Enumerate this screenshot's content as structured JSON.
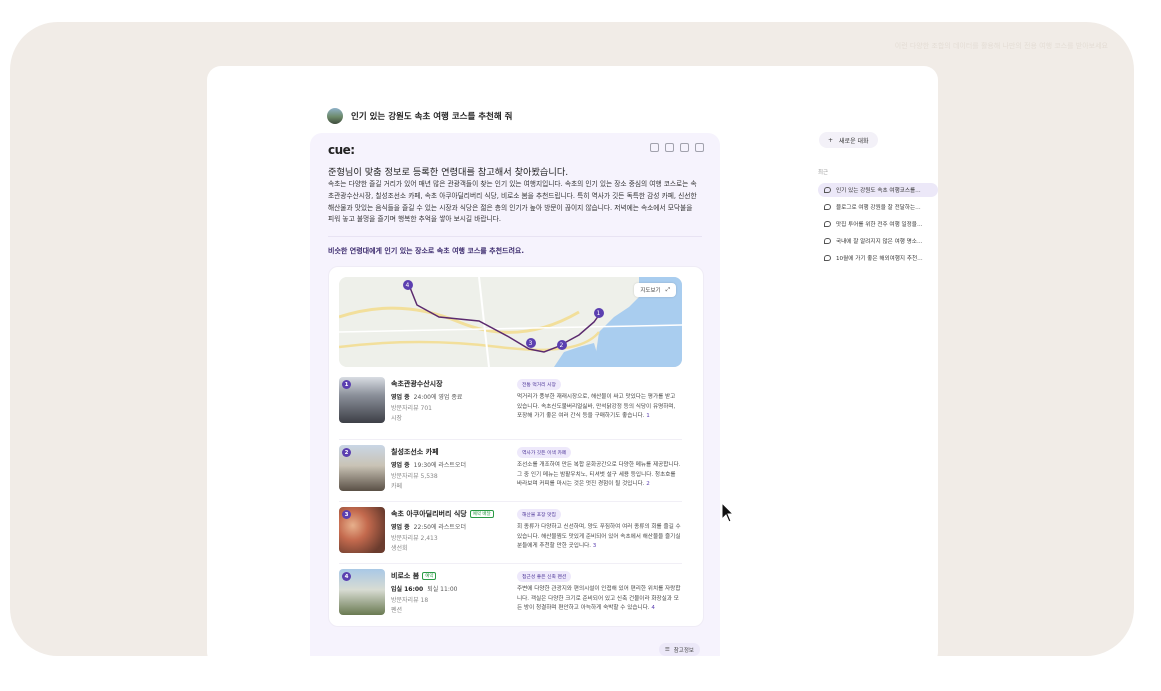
{
  "background_hint": "이런 다양한 조합의 데이터를 활용해 나만의 전용 여행 코스를 받아보세요",
  "question": {
    "text": "인기 있는 강원도 속초 여행 코스를 추천해 줘"
  },
  "answer": {
    "logo": "cue:",
    "actions": [
      "copy-icon",
      "thumbs-up-icon",
      "thumbs-down-icon",
      "share-icon"
    ],
    "heading": "준형님이 맞춤 정보로 등록한 연령대를 참고해서 찾아봤습니다.",
    "body": "속초는 다양한 즐길 거리가 있어 매년 많은 관광객들이 찾는 인기 있는 여행지입니다. 속초의 인기 있는 장소 중심의 여행 코스로는 속초관광수산시장, 칠성조선소 카페, 속초 아쿠아딜리버리 식당, 비로소 봄을 추천드립니다. 특히 역사가 깃든 독특한 감성 카페, 신선한 해산물과 맛있는 음식들을 즐길 수 있는 시장과 식당은 젊은 층의 인기가 높아 방문이 끊이지 않습니다. 저녁에는 속소에서 모닥불을 피워 놓고 불멍을 즐기며 행복한 추억을 쌓아 보시길 바랍니다.",
    "sub_heading": "비슷한 연령대에게 인기 있는 장소로 속초 여행 코스를 추천드려요.",
    "map_button": "지도보기",
    "places": [
      {
        "num": "1",
        "name": "속초관광수산시장",
        "badge": "",
        "status_open": "영업 중",
        "status_detail": "24:00에 영업 종료",
        "reviews": "방문자리뷰 701",
        "category": "시장",
        "tag": "전통 먹거리 시장",
        "desc": "먹거리가 풍부한 재래시장으로, 해산물이 싸고 맛있다는 평가를 받고 있습니다. 속초신도불버리얼싫바, 만석닭강정 등의 식당이 유명하며, 포장해 가기 좋은 여러 간식 등을 구매하기도 좋습니다.",
        "ref": "1"
      },
      {
        "num": "2",
        "name": "칠성조선소 카페",
        "badge": "",
        "status_open": "영업 중",
        "status_detail": "19:30에 라스트오더",
        "reviews": "방문자리뷰 5,538",
        "category": "카페",
        "tag": "역사가 깃든 이색 카페",
        "desc": "조선소를 개조하여 만든 복합 문화공간으로 다양한 메뉴를 제공합니다. 그 중 인기 메뉴는 밤팥우치노, 티셔벗 설구 세용 등입니다. 청초호를 바라보며 커피를 마시는 것은 멋진 경험이 될 것입니다.",
        "ref": "2"
      },
      {
        "num": "3",
        "name": "속초 아쿠아딜리버리 식당",
        "badge": "예약 배달",
        "status_open": "영업 중",
        "status_detail": "22:50에 라스트오더",
        "reviews": "방문자리뷰 2,413",
        "category": "생선회",
        "tag": "해산물 포장 맛집",
        "desc": "회 종류가 다양하고 신선하며, 양도 푸짐하여 여러 종류의 회를 즐길 수 있습니다. 해산물찜도 맛있게 준비되어 있어 속초에서 해산물을 즐기실 분들에게 추천할 만한 곳입니다.",
        "ref": "3"
      },
      {
        "num": "4",
        "name": "비로소 봄",
        "badge": "예약",
        "status_open": "입실 16:00",
        "status_detail": "퇴실 11:00",
        "reviews": "방문자리뷰 18",
        "category": "펜션",
        "tag": "접근성 좋은 신축 펜션",
        "desc": "주변에 다양한 관광지와 편의시설이 인접해 있어 편리한 위치를 자랑합니다. 객실은 다양한 크기로 준비되어 있고 신축 건물이라 화장실과 모든 방이 청결하며 편안하고 아늑하게 숙박할 수 있습니다.",
        "ref": "4"
      }
    ],
    "reference_button": "참고정보"
  },
  "sidebar": {
    "new_chat_label": "새로운 대화",
    "recent_label": "최근",
    "history": [
      {
        "label": "인기 있는 강원도 속초 여행코스를…",
        "active": true
      },
      {
        "label": "블로그로 여행 강원을 잘 전달하는…",
        "active": false
      },
      {
        "label": "맛집 투어를 위한 전주 여행 일정을…",
        "active": false
      },
      {
        "label": "국내에 잘 알려지지 않은 여행 명소…",
        "active": false
      },
      {
        "label": "10월에 가기 좋은 해외여행지 추천…",
        "active": false
      }
    ]
  },
  "colors": {
    "accent": "#5b3fb0",
    "card_bg": "#f6f3fd",
    "frame_bg": "#f1ece7"
  }
}
